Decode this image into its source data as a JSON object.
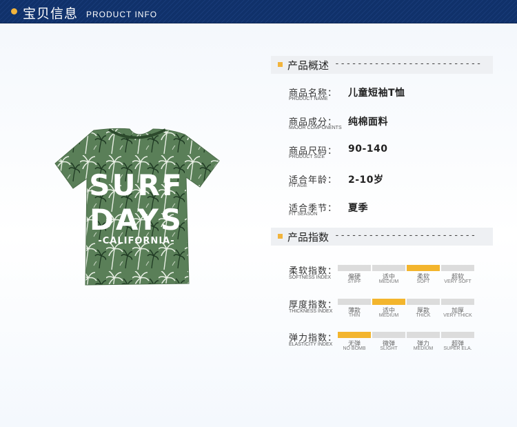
{
  "header": {
    "title_cn": "宝贝信息",
    "title_en": "PRODUCT INFO"
  },
  "product_image": {
    "print_line1": "SURF",
    "print_line2": "DAYS",
    "print_line3": "-CALIFORNIA-",
    "shirt_color": "#5a7f58"
  },
  "overview": {
    "title": "产品概述",
    "dashes": "--------------------------",
    "rows": [
      {
        "label_cn": "商品名称：",
        "label_en": "PRODUCT NAME",
        "value": "儿童短袖T恤"
      },
      {
        "label_cn": "商品成分：",
        "label_en": "MAJOR COMPONENTS",
        "value": "纯棉面料"
      },
      {
        "label_cn": "商品尺码：",
        "label_en": "PRODUCT SIZE",
        "value": "90-140"
      },
      {
        "label_cn": "适合年龄：",
        "label_en": "FIT AGE",
        "value": "2-10岁"
      },
      {
        "label_cn": "适合季节：",
        "label_en": "FIT SEASON",
        "value": "夏季"
      }
    ]
  },
  "indices": {
    "title": "产品指数",
    "dashes": "-------------------------",
    "active_color": "#f3b52d",
    "inactive_color": "#dcdcdc",
    "rows": [
      {
        "label_cn": "柔软指数：",
        "label_en": "SOFTNESS INDEX",
        "active": 2,
        "levels": [
          {
            "cn": "偏硬",
            "en": "STIFF"
          },
          {
            "cn": "适中",
            "en": "MEDIUM"
          },
          {
            "cn": "柔软",
            "en": "SOFT"
          },
          {
            "cn": "超软",
            "en": "VERY SOFT"
          }
        ]
      },
      {
        "label_cn": "厚度指数：",
        "label_en": "THICKNESS INDEX",
        "active": 1,
        "levels": [
          {
            "cn": "薄款",
            "en": "THIN"
          },
          {
            "cn": "适中",
            "en": "MEDIUM"
          },
          {
            "cn": "厚款",
            "en": "THICK"
          },
          {
            "cn": "加厚",
            "en": "VERY THICK"
          }
        ]
      },
      {
        "label_cn": "弹力指数：",
        "label_en": "ELASTICITY INDEX",
        "active": 0,
        "levels": [
          {
            "cn": "无弹",
            "en": "NO BOMB"
          },
          {
            "cn": "微弹",
            "en": "SLIGHT"
          },
          {
            "cn": "弹力",
            "en": "MEDIUM"
          },
          {
            "cn": "超弹",
            "en": "SUPER ELA."
          }
        ]
      }
    ]
  }
}
